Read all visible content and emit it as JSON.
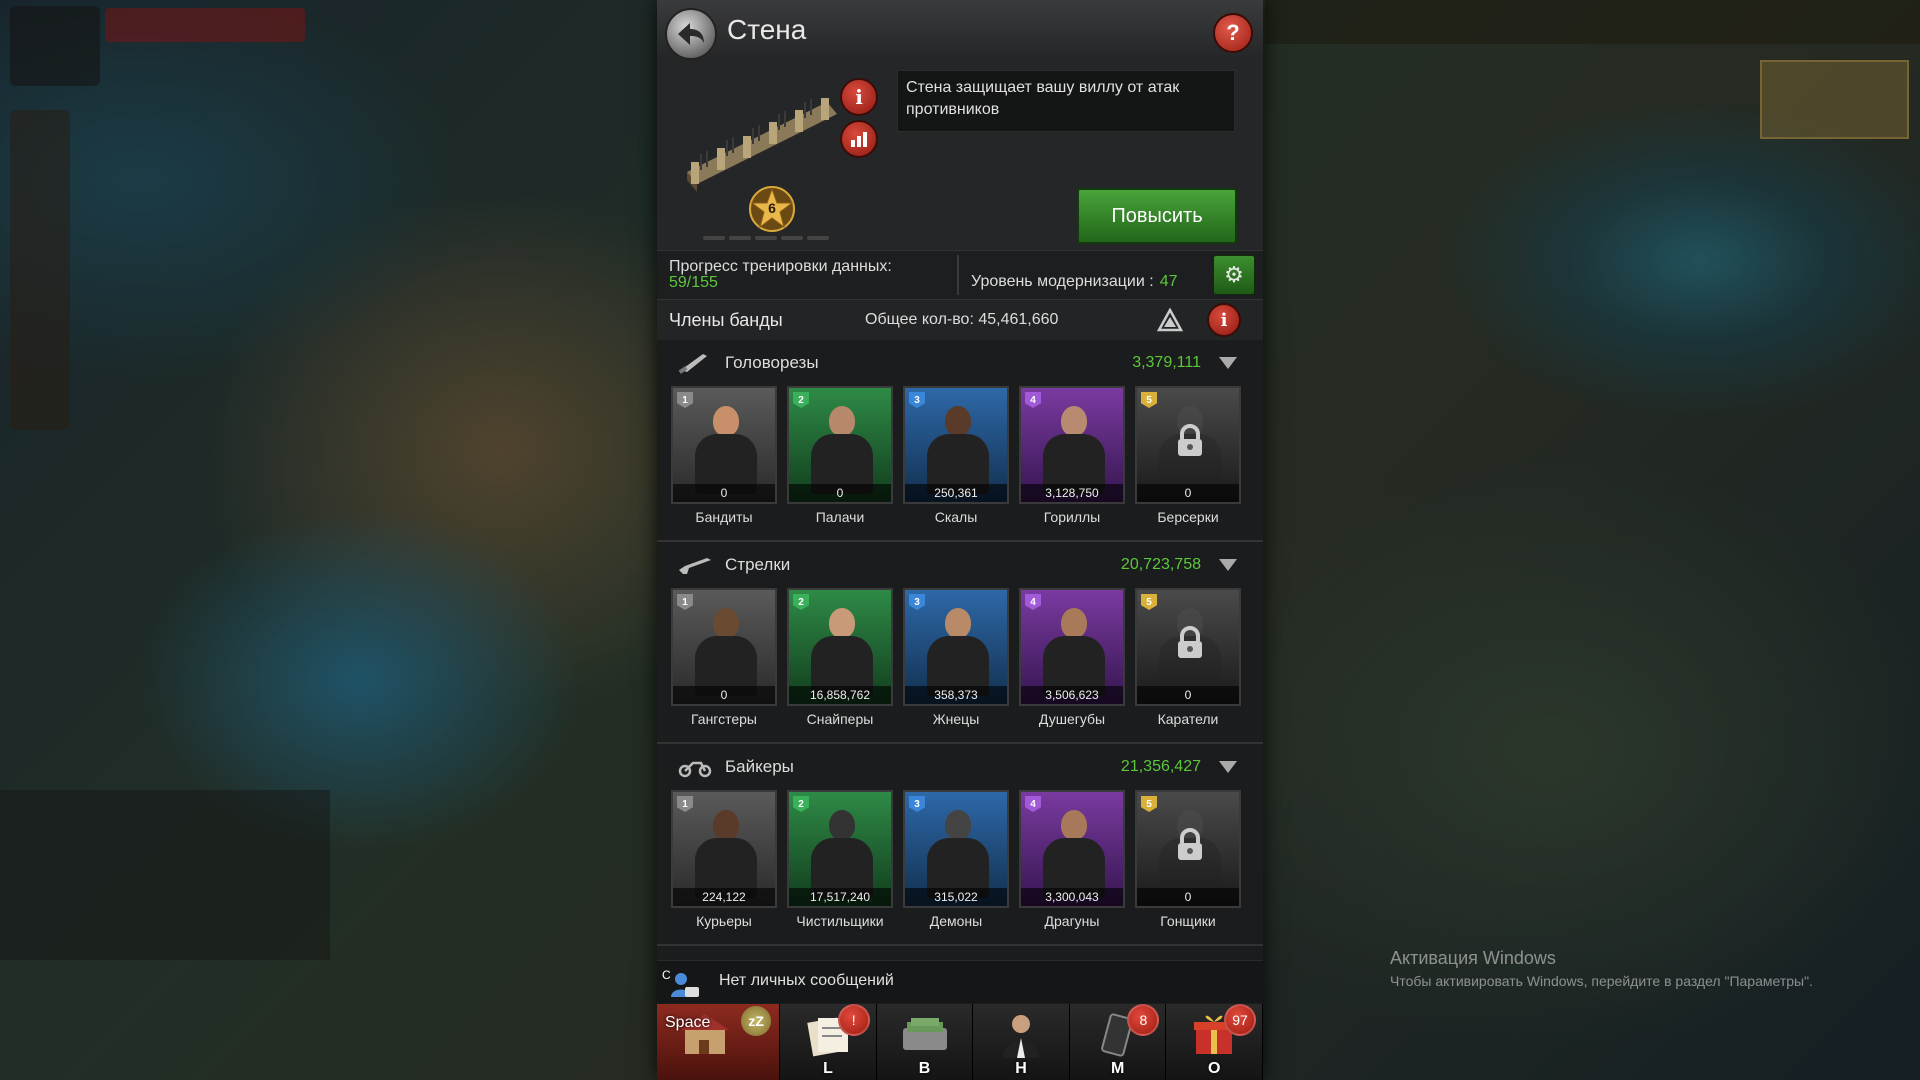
{
  "header": {
    "title": "Стена"
  },
  "building": {
    "level": "6",
    "description": "Стена защищает вашу виллу от атак противников",
    "upgrade_label": "Повысить"
  },
  "stats": {
    "training_label": "Прогресс тренировки данных:",
    "training_value": "59/155",
    "modernization_label": "Уровень модернизации :",
    "modernization_value": "47"
  },
  "members": {
    "title": "Члены банды",
    "total_label": "Общее кол-во: 45,461,660"
  },
  "sections": [
    {
      "title": "Головорезы",
      "total": "3,379,111",
      "icon": "knife-icon",
      "units": [
        {
          "name": "Бандиты",
          "count": "0",
          "tier": "1",
          "locked": false,
          "skin": "#c8906a"
        },
        {
          "name": "Палачи",
          "count": "0",
          "tier": "2",
          "locked": false,
          "skin": "#b8886a"
        },
        {
          "name": "Скалы",
          "count": "250,361",
          "tier": "3",
          "locked": false,
          "skin": "#5a3a28"
        },
        {
          "name": "Гориллы",
          "count": "3,128,750",
          "tier": "4",
          "locked": false,
          "skin": "#b88a70"
        },
        {
          "name": "Берсерки",
          "count": "0",
          "tier": "5",
          "locked": true,
          "skin": "#555555"
        }
      ]
    },
    {
      "title": "Стрелки",
      "total": "20,723,758",
      "icon": "rifle-icon",
      "units": [
        {
          "name": "Гангстеры",
          "count": "0",
          "tier": "1",
          "locked": false,
          "skin": "#6a4a30"
        },
        {
          "name": "Снайперы",
          "count": "16,858,762",
          "tier": "2",
          "locked": false,
          "skin": "#c89a78"
        },
        {
          "name": "Жнецы",
          "count": "358,373",
          "tier": "3",
          "locked": false,
          "skin": "#b88a68"
        },
        {
          "name": "Душегубы",
          "count": "3,506,623",
          "tier": "4",
          "locked": false,
          "skin": "#a87a5a"
        },
        {
          "name": "Каратели",
          "count": "0",
          "tier": "5",
          "locked": true,
          "skin": "#555555"
        }
      ]
    },
    {
      "title": "Байкеры",
      "total": "21,356,427",
      "icon": "motorcycle-icon",
      "units": [
        {
          "name": "Курьеры",
          "count": "224,122",
          "tier": "1",
          "locked": false,
          "skin": "#5a3a28"
        },
        {
          "name": "Чистильщики",
          "count": "17,517,240",
          "tier": "2",
          "locked": false,
          "skin": "#333333"
        },
        {
          "name": "Демоны",
          "count": "315,022",
          "tier": "3",
          "locked": false,
          "skin": "#444444"
        },
        {
          "name": "Драгуны",
          "count": "3,300,043",
          "tier": "4",
          "locked": false,
          "skin": "#a8785a"
        },
        {
          "name": "Гонщики",
          "count": "0",
          "tier": "5",
          "locked": true,
          "skin": "#555555"
        }
      ]
    }
  ],
  "messages": {
    "text": "Нет личных сообщений",
    "key": "C"
  },
  "bottom_nav": [
    {
      "key": "Space",
      "badge": "",
      "icon": "villa-icon"
    },
    {
      "key": "L",
      "badge": "!",
      "icon": "quests-icon"
    },
    {
      "key": "B",
      "badge": "",
      "icon": "bag-icon"
    },
    {
      "key": "H",
      "badge": "",
      "icon": "hero-icon"
    },
    {
      "key": "M",
      "badge": "8",
      "icon": "phone-icon"
    },
    {
      "key": "O",
      "badge": "97",
      "icon": "gift-icon"
    }
  ],
  "watermark": {
    "title": "Активация Windows",
    "subtitle": "Чтобы активировать Windows, перейдите в раздел \"Параметры\"."
  }
}
